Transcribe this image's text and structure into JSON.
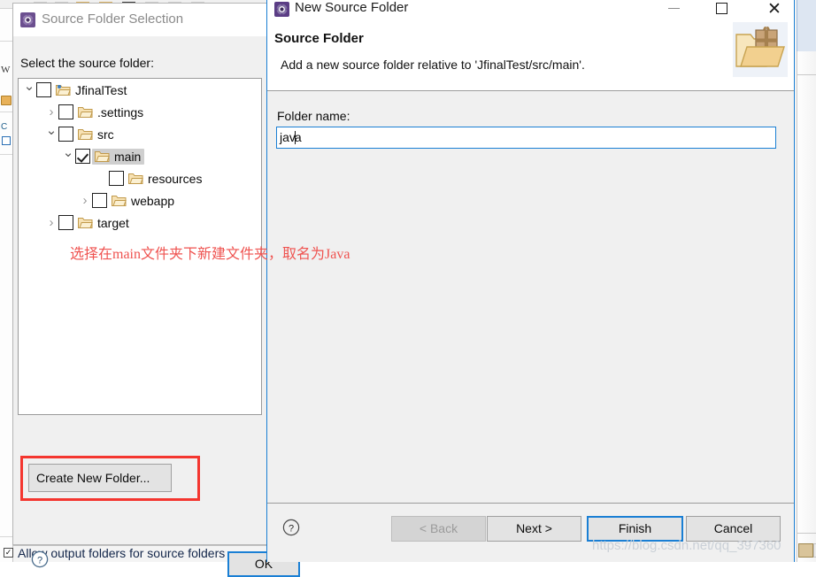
{
  "background": {
    "left_strip_glyphs": [
      "W",
      "C"
    ],
    "bottom_checkbox": {
      "label": "Allow output folders for source folders",
      "checked": true
    }
  },
  "source_folder_selection": {
    "title": "Source Folder Selection",
    "title_icon": "eclipse-gear-icon",
    "prompt": "Select the source folder:",
    "tree": [
      {
        "label": "JfinalTest",
        "depth": 0,
        "arrow": "down",
        "checked": false,
        "selected": false,
        "icon": "folder-project-icon"
      },
      {
        "label": ".settings",
        "depth": 1,
        "arrow": "right",
        "checked": false,
        "selected": false,
        "icon": "folder-icon"
      },
      {
        "label": "src",
        "depth": 1,
        "arrow": "down",
        "checked": false,
        "selected": false,
        "icon": "folder-icon"
      },
      {
        "label": "main",
        "depth": 2,
        "arrow": "down",
        "checked": true,
        "selected": true,
        "icon": "folder-icon"
      },
      {
        "label": "resources",
        "depth": 3,
        "arrow": "none",
        "checked": false,
        "selected": false,
        "icon": "folder-icon"
      },
      {
        "label": "webapp",
        "depth": 2.5,
        "arrow": "right",
        "checked": false,
        "selected": false,
        "icon": "folder-icon"
      },
      {
        "label": "target",
        "depth": 1,
        "arrow": "right",
        "checked": false,
        "selected": false,
        "icon": "folder-icon"
      }
    ],
    "create_new_folder_button": "Create New Folder...",
    "help_icon": "help-question-icon",
    "ok_button": "OK"
  },
  "annotation": {
    "text": "选择在main文件夹下新建文件夹，取名为Java",
    "color": "#ef5350"
  },
  "new_source_folder": {
    "window_title": "New Source Folder",
    "title_icon": "eclipse-gear-icon",
    "window_controls": {
      "minimize": "minimize-icon",
      "maximize": "maximize-icon",
      "close": "✕"
    },
    "header": {
      "title": "Source Folder",
      "description": "Add a new source folder relative to 'JfinalTest/src/main'.",
      "icon": "folder-with-gift-icon"
    },
    "form": {
      "folder_name_label": "Folder name:",
      "folder_name_value_before_caret": "jav",
      "folder_name_value_after_caret": "a",
      "folder_name_value": "java"
    },
    "footer": {
      "help_icon": "help-question-icon",
      "buttons": [
        {
          "label": "< Back",
          "enabled": false,
          "default": false
        },
        {
          "label": "Next >",
          "enabled": true,
          "default": false
        },
        {
          "label": "Finish",
          "enabled": true,
          "default": true
        },
        {
          "label": "Cancel",
          "enabled": true,
          "default": false
        }
      ]
    }
  },
  "watermark": {
    "text": "https://blog.csdn.net/qq_397360"
  },
  "colors": {
    "accent_blue": "#1a7fd4",
    "highlight_red": "#f4362f",
    "annotation_red": "#ef5350",
    "dialog_bg": "#f0f0f0",
    "selection_gray": "#cfcfcf"
  }
}
